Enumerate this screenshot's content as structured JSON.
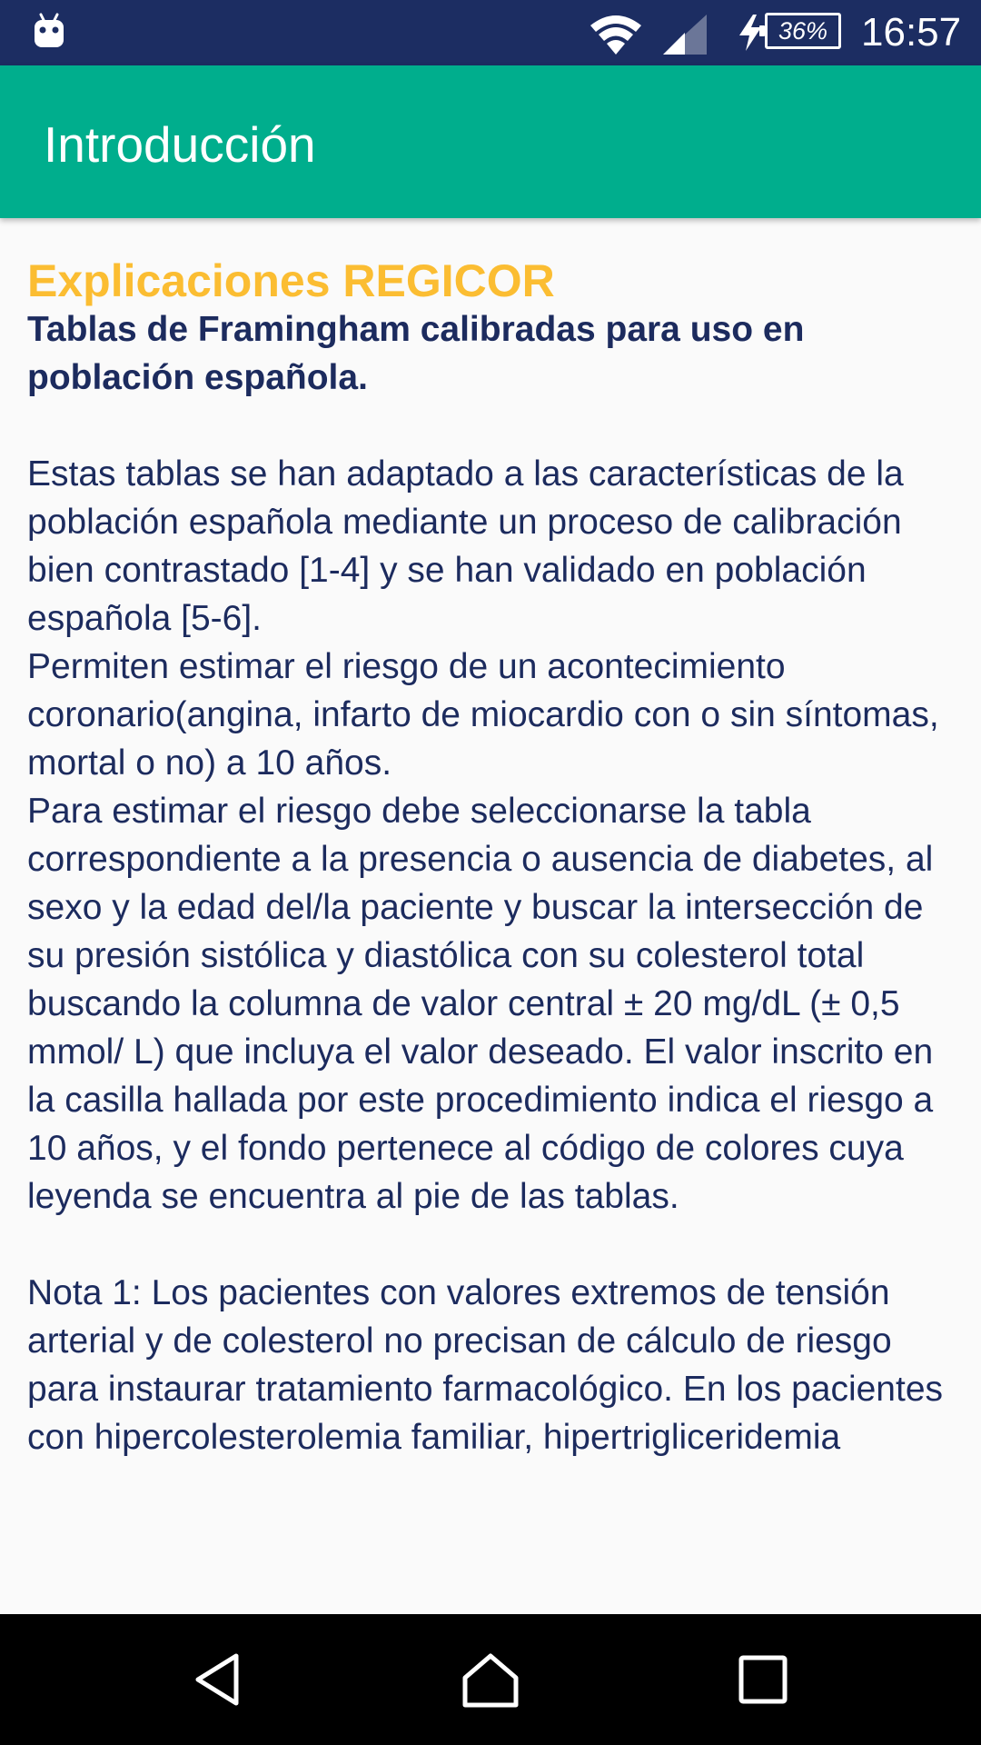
{
  "status_bar": {
    "battery": "36%",
    "clock": "16:57",
    "icons": [
      "android-icon",
      "wifi-icon",
      "signal-icon",
      "charging-bolt-icon",
      "battery-icon"
    ]
  },
  "app_bar": {
    "title": "Introducción"
  },
  "content": {
    "heading": "Explicaciones REGICOR",
    "subheading": "Tablas de Framingham calibradas para uso en población española.",
    "paragraphs": [
      "Estas tablas se han adaptado a las características de la población española mediante un proceso de calibración bien contrastado [1-4] y se han validado en población española [5-6].",
      " Permiten estimar el riesgo de un acontecimiento coronario(angina, infarto de miocardio con o sin síntomas, mortal o no) a 10 años.",
      " Para estimar el riesgo debe seleccionarse la tabla correspondiente a la presencia o ausencia de diabetes, al sexo y la edad del/la paciente y buscar la intersección de su presión sistólica y diastólica con su colesterol total buscando la columna de valor central ± 20 mg/dL (± 0,5 mmol/ L) que incluya el valor deseado. El valor inscrito en la casilla hallada por este procedimiento indica el riesgo a 10 años, y el fondo pertenece al código de colores cuya leyenda se encuentra al pie de las tablas.",
      "Nota 1: Los pacientes con valores extremos de tensión arterial y de colesterol no precisan de cálculo de riesgo para instaurar tratamiento farmacológico. En los pacientes con hipercolesterolemia familiar, hipertrigliceridemia"
    ]
  },
  "nav_bar": {
    "buttons": [
      "back-icon",
      "home-icon",
      "recents-icon"
    ]
  },
  "colors": {
    "status_bar": "#1c2d62",
    "app_bar": "#00ae8d",
    "heading": "#fbbd32",
    "body_text": "#1c2b5e",
    "background": "#fafafa",
    "nav_bar": "#000000"
  }
}
